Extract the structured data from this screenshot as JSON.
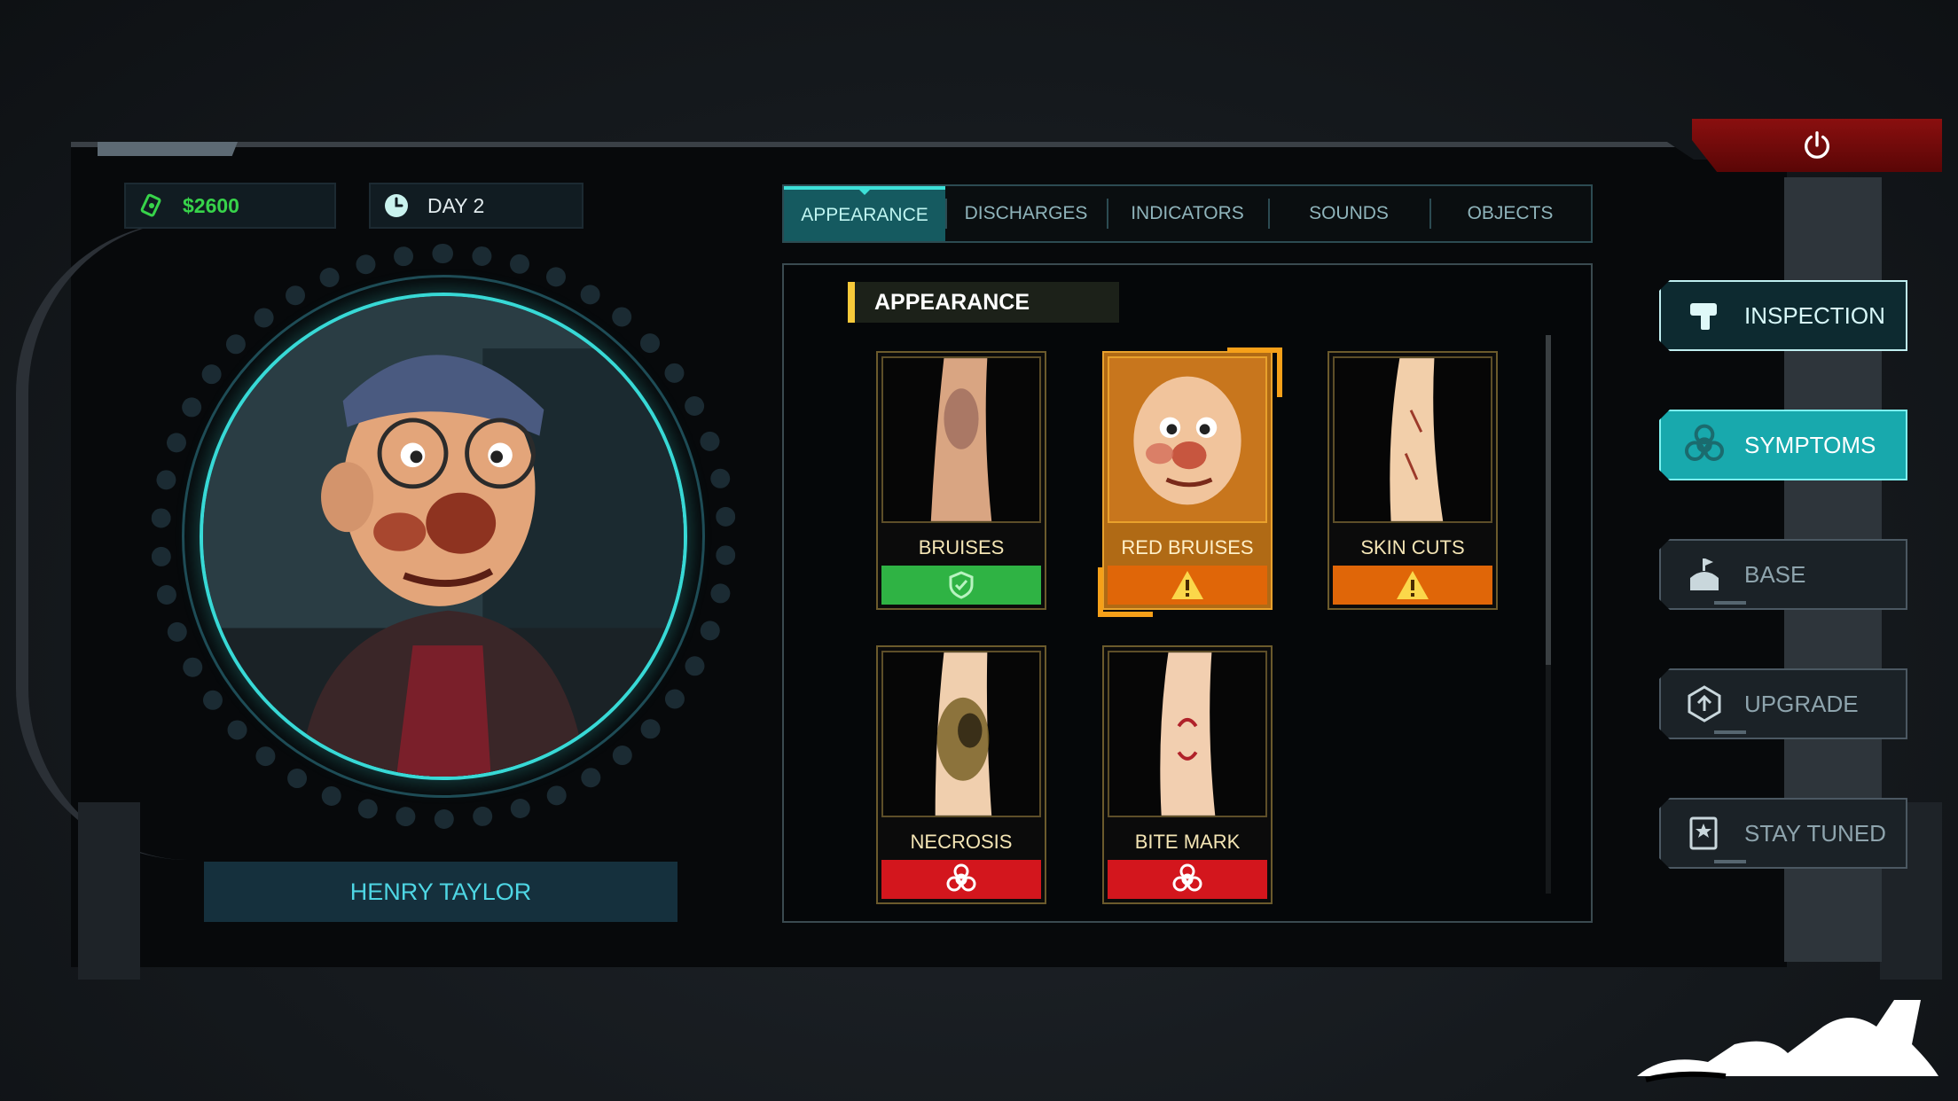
{
  "hud": {
    "money": "$2600",
    "day": "DAY 2"
  },
  "patient": {
    "name": "HENRY TAYLOR"
  },
  "tabs": [
    {
      "label": "APPEARANCE",
      "active": true
    },
    {
      "label": "DISCHARGES",
      "active": false
    },
    {
      "label": "INDICATORS",
      "active": false
    },
    {
      "label": "SOUNDS",
      "active": false
    },
    {
      "label": "OBJECTS",
      "active": false
    }
  ],
  "section": {
    "title": "APPEARANCE"
  },
  "cards": [
    {
      "label": "BRUISES",
      "status": "safe",
      "status_icon": "shield-check-icon"
    },
    {
      "label": "RED BRUISES",
      "status": "warning",
      "status_icon": "warning-icon",
      "selected": true
    },
    {
      "label": "SKIN CUTS",
      "status": "warning",
      "status_icon": "warning-icon"
    },
    {
      "label": "NECROSIS",
      "status": "danger",
      "status_icon": "biohazard-icon"
    },
    {
      "label": "BITE MARK",
      "status": "danger",
      "status_icon": "biohazard-icon"
    }
  ],
  "menu": [
    {
      "label": "INSPECTION",
      "icon": "thermometer-gun-icon",
      "state": "active"
    },
    {
      "label": "SYMPTOMS",
      "icon": "biohazard-icon",
      "state": "highlight"
    },
    {
      "label": "BASE",
      "icon": "base-icon",
      "state": "normal"
    },
    {
      "label": "UPGRADE",
      "icon": "upgrade-icon",
      "state": "normal"
    },
    {
      "label": "STAY TUNED",
      "icon": "book-star-icon",
      "state": "normal"
    }
  ],
  "colors": {
    "accent": "#3de0d8",
    "money": "#37d34a",
    "safe": "#2fb344",
    "warning": "#e06608",
    "danger": "#d3161d",
    "power": "#8a0f0f"
  }
}
